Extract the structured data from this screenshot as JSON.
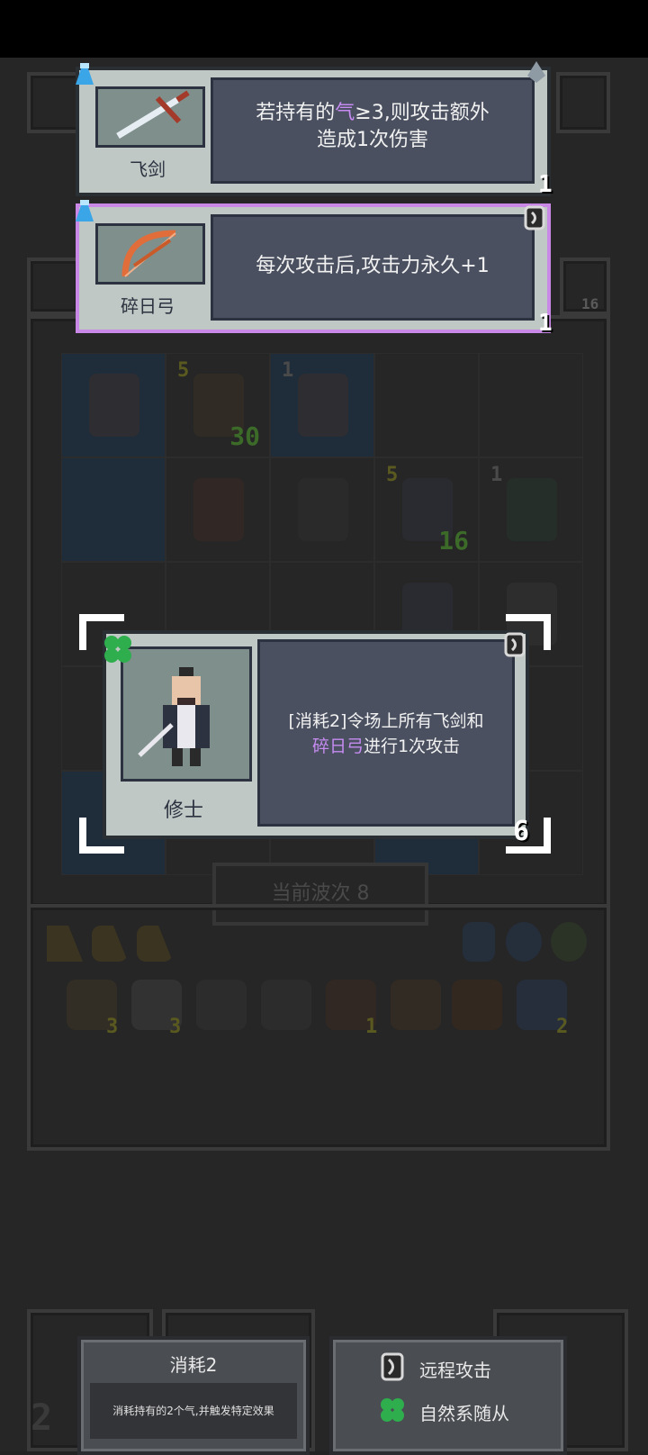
{
  "cards": {
    "flying_sword": {
      "name": "飞剑",
      "desc_line1_a": "若持有的",
      "desc_line1_qi": "气",
      "desc_line1_b": "≥3,则攻击额外",
      "desc_line2": "造成1次伤害",
      "count": "1"
    },
    "sun_bow": {
      "name": "碎日弓",
      "desc": "每次攻击后,攻击力永久+1",
      "count": "1"
    },
    "cultivator": {
      "name": "修士",
      "desc_line1": "[消耗2]令场上所有飞剑和",
      "desc_line2_hl": "碎日弓",
      "desc_line2": "进行1次攻击",
      "count": "6"
    }
  },
  "board": {
    "wave_label": "当前波次 8",
    "levels": [
      "5",
      "1",
      "5",
      "1"
    ],
    "stacks": [
      "30",
      "16"
    ],
    "side_badge": "16"
  },
  "inventory": {
    "counts": [
      "3",
      "3",
      "1",
      "2"
    ]
  },
  "bottom": {
    "consume_title": "消耗2",
    "consume_desc": "消耗持有的2个气,并触发特定效果",
    "tag_ranged": "远程攻击",
    "tag_nature": "自然系随从",
    "left_digit": "2"
  },
  "colors": {
    "qi_highlight": "#c58bf0",
    "bow_highlight": "#c58bf0",
    "card_frame_purple": "#c987e6"
  }
}
